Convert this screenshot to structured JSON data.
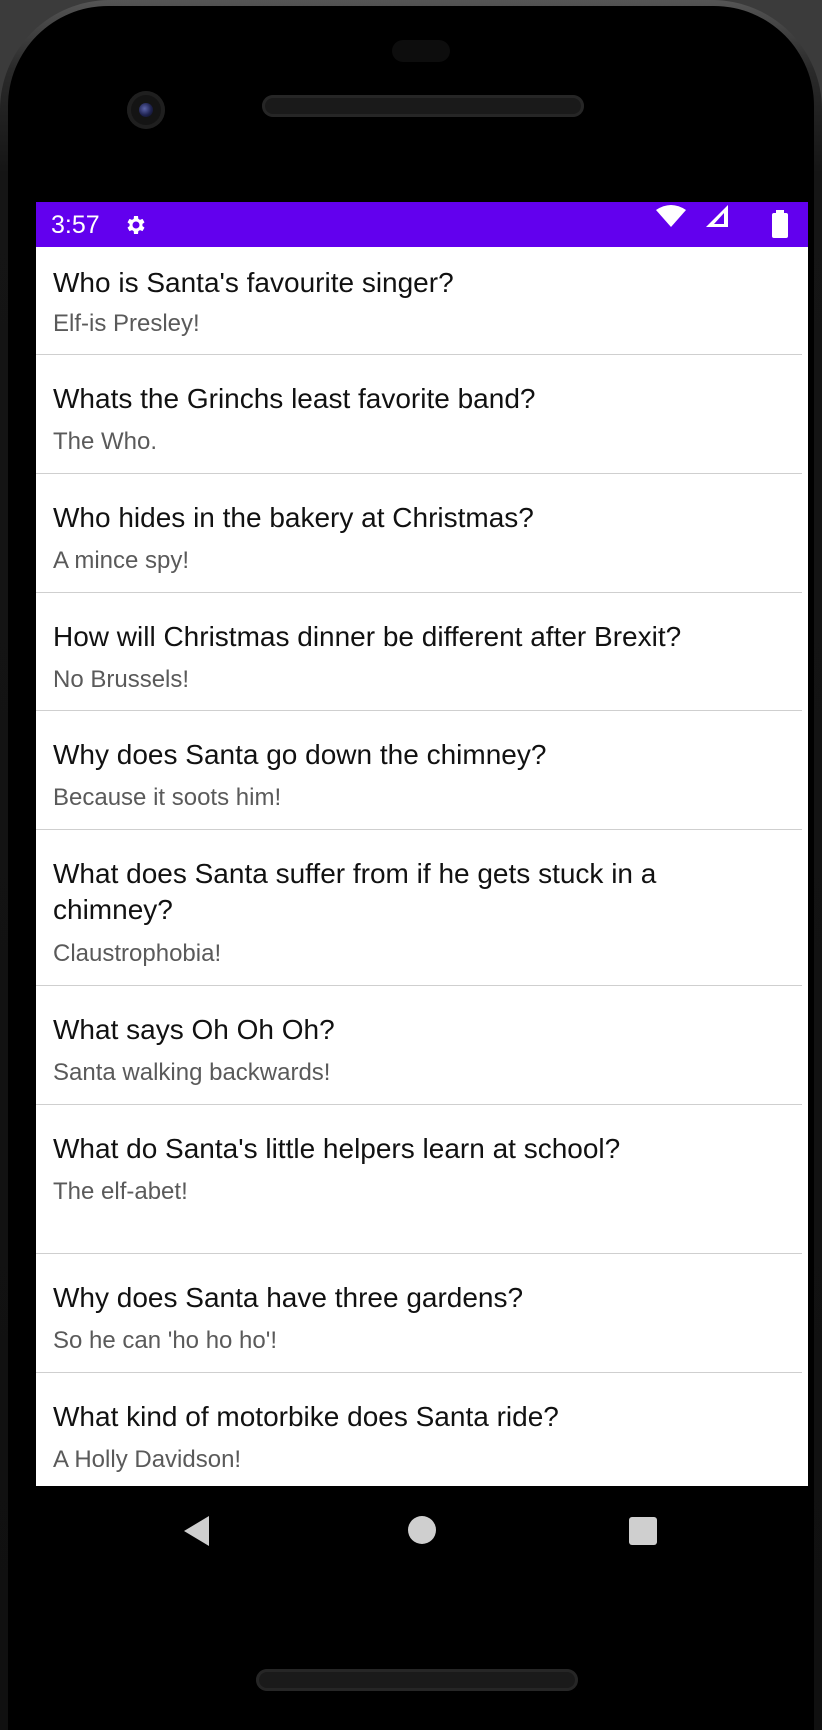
{
  "status_bar": {
    "time": "3:57",
    "icons": [
      "gear-icon",
      "wifi-icon",
      "signal-icon",
      "battery-icon"
    ],
    "color": "#6200ee"
  },
  "jokes": [
    {
      "question": "Who is Santa's favourite singer?",
      "answer": "Elf-is Presley!"
    },
    {
      "question": "Whats the Grinchs least favorite band?",
      "answer": "The Who."
    },
    {
      "question": "Who hides in the bakery at Christmas?",
      "answer": "A mince spy!"
    },
    {
      "question": "How will Christmas dinner be different after Brexit?",
      "answer": "No Brussels!"
    },
    {
      "question": "Why does Santa go down the chimney?",
      "answer": "Because it soots him!"
    },
    {
      "question": "What does Santa suffer from if he gets stuck in a chimney?",
      "answer": "Claustrophobia!"
    },
    {
      "question": "What says Oh Oh Oh?",
      "answer": "Santa walking backwards!"
    },
    {
      "question": "What do Santa's little helpers learn at school?",
      "answer": "The elf-abet!"
    },
    {
      "question": "Why does Santa have three gardens?",
      "answer": "So he can 'ho ho ho'!"
    },
    {
      "question": "What kind of motorbike does Santa ride?",
      "answer": "A Holly Davidson!"
    }
  ],
  "nav_bar": {
    "icons": [
      "back-icon",
      "home-icon",
      "recents-icon"
    ]
  }
}
